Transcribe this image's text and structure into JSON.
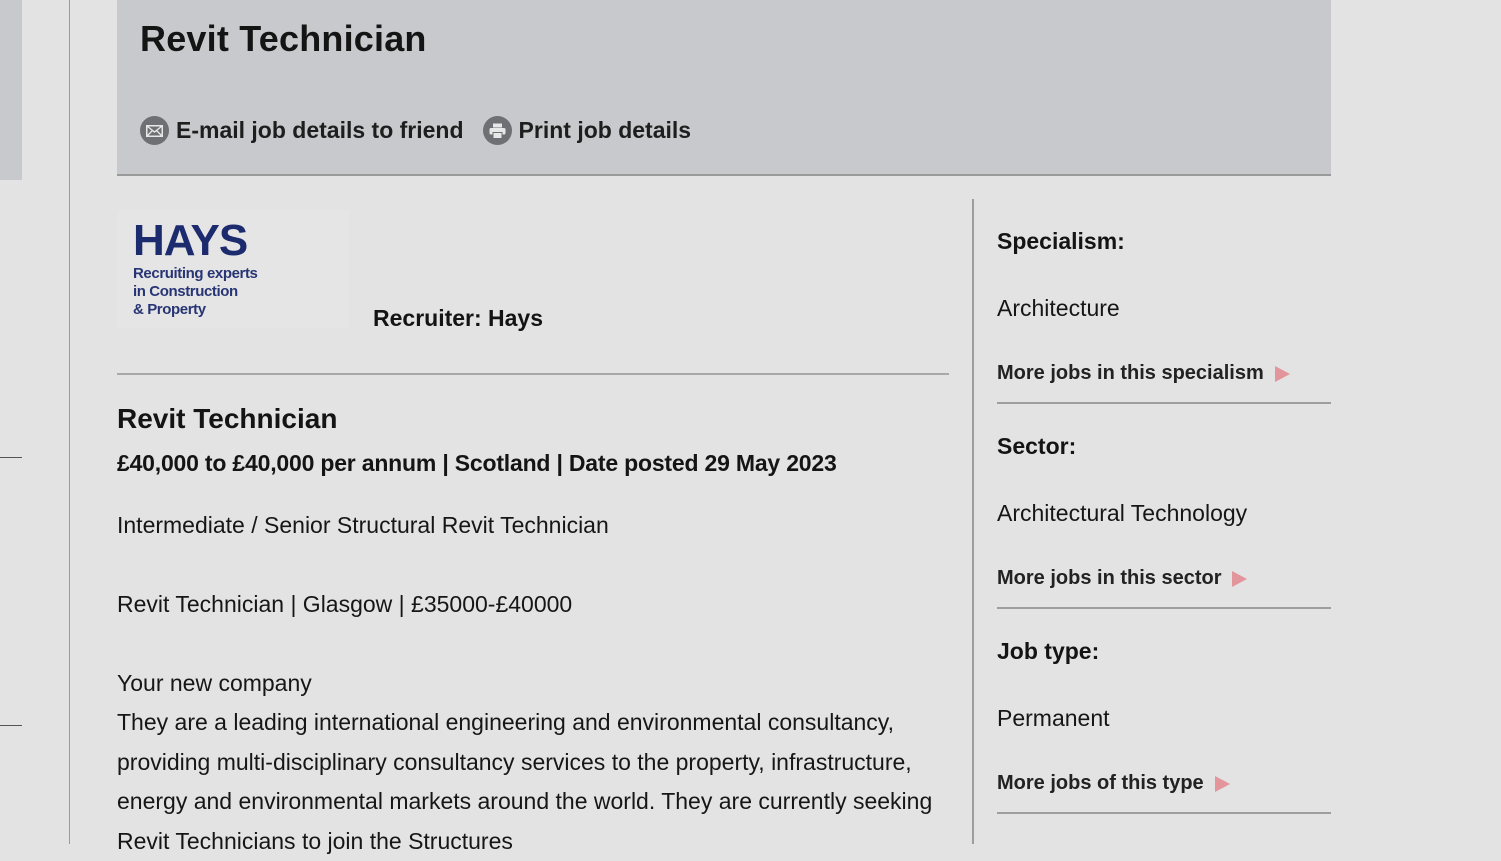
{
  "header": {
    "title": "Revit Technician",
    "actions": [
      {
        "label": "E-mail job details to friend",
        "icon": "envelope-icon"
      },
      {
        "label": "Print job details",
        "icon": "printer-icon"
      }
    ]
  },
  "recruiter": {
    "logo": {
      "brand": "HAYS",
      "tagline": [
        "Recruiting experts",
        "in Construction",
        "& Property"
      ],
      "brand_color": "#1c2a6e"
    },
    "label": "Recruiter: Hays"
  },
  "job": {
    "title": "Revit Technician",
    "meta": "£40,000 to £40,000 per annum | Scotland | Date posted 29 May 2023",
    "subtitle": "Intermediate / Senior Structural Revit Technician",
    "summary": "Revit Technician | Glasgow | £35000-£40000",
    "section_heading": "Your new company",
    "description": "They are a leading international engineering and environmental consultancy, providing multi-disciplinary consultancy services to the property, infrastructure, energy and environmental markets around the world. They are currently seeking Revit Technicians to join the Structures"
  },
  "sidebar": {
    "arrow_color": "#e2959b",
    "sections": [
      {
        "heading": "Specialism:",
        "value": "Architecture",
        "link": "More jobs in this specialism"
      },
      {
        "heading": "Sector:",
        "value": "Architectural Technology",
        "link": "More jobs in this sector"
      },
      {
        "heading": "Job type:",
        "value": "Permanent",
        "link": "More jobs of this type"
      }
    ]
  }
}
